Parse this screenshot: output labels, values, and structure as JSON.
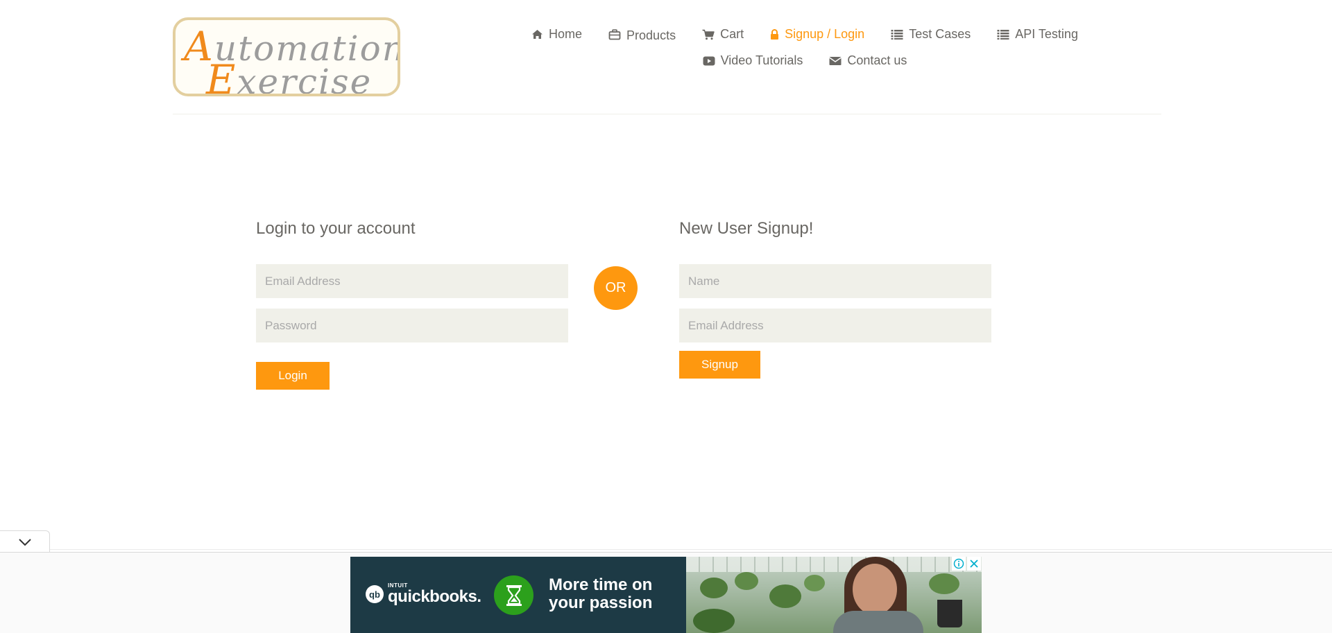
{
  "header": {
    "logo": {
      "line1_cap": "A",
      "line1_rest": "utomation",
      "line2_cap": "E",
      "line2_rest": "xercise"
    },
    "nav": [
      {
        "label": "Home",
        "icon": "home-icon"
      },
      {
        "label": "Products",
        "icon": "briefcase-icon"
      },
      {
        "label": "Cart",
        "icon": "cart-icon"
      },
      {
        "label": "Signup / Login",
        "icon": "lock-icon",
        "active": true
      },
      {
        "label": "Test Cases",
        "icon": "list-icon"
      },
      {
        "label": "API Testing",
        "icon": "list-icon"
      },
      {
        "label": "Video Tutorials",
        "icon": "youtube-play-icon"
      },
      {
        "label": "Contact us",
        "icon": "envelope-icon"
      }
    ]
  },
  "login": {
    "title": "Login to your account",
    "email_placeholder": "Email Address",
    "password_placeholder": "Password",
    "button_label": "Login"
  },
  "or_label": "OR",
  "signup": {
    "title": "New User Signup!",
    "name_placeholder": "Name",
    "email_placeholder": "Email Address",
    "button_label": "Signup"
  },
  "ad": {
    "brand_prefix": "qb",
    "brand_super": "INTUIT",
    "brand": "quickbooks.",
    "headline": "More time on\nyour passion"
  },
  "colors": {
    "accent": "#fe980f",
    "text": "#696763",
    "field_bg": "#f0f0e9",
    "ad_bg": "#1d3a45",
    "ad_green": "#2ca01c"
  }
}
